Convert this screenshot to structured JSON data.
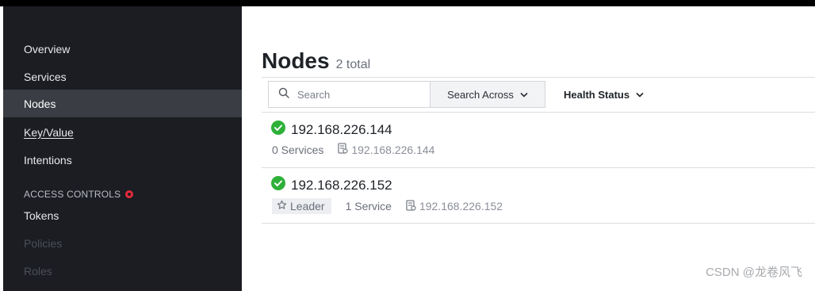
{
  "sidebar": {
    "items": [
      {
        "label": "Overview"
      },
      {
        "label": "Services"
      },
      {
        "label": "Nodes"
      },
      {
        "label": "Key/Value"
      },
      {
        "label": "Intentions"
      }
    ],
    "access_heading": "ACCESS CONTROLS",
    "access_items": [
      {
        "label": "Tokens"
      },
      {
        "label": "Policies"
      },
      {
        "label": "Roles"
      }
    ]
  },
  "main": {
    "title": "Nodes",
    "count": "2 total",
    "search": {
      "placeholder": "Search"
    },
    "search_across": "Search Across",
    "health_status": "Health Status",
    "nodes": [
      {
        "name": "192.168.226.144",
        "services": "0 Services",
        "address": "192.168.226.144"
      },
      {
        "name": "192.168.226.152",
        "leader": "Leader",
        "services": "1 Service",
        "address": "192.168.226.152"
      }
    ]
  },
  "colors": {
    "sidebar_bg": "#1b1d22",
    "active_bg": "#3a3d44",
    "healthy": "#2eb039",
    "acl_dot": "#e5293b"
  },
  "watermark": "CSDN @龙卷风飞"
}
